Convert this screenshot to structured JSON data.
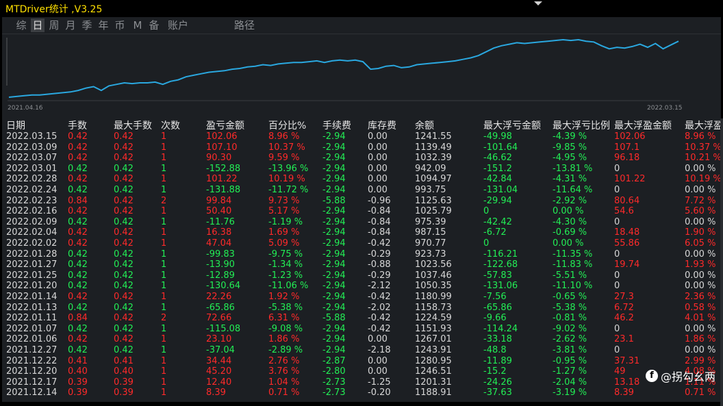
{
  "app": {
    "title": "MTDriver统计 ,V3.25"
  },
  "tabs": [
    {
      "label": "综",
      "active": false
    },
    {
      "label": "日",
      "active": true
    },
    {
      "label": "周",
      "active": false
    },
    {
      "label": "月",
      "active": false
    },
    {
      "label": "季",
      "active": false
    },
    {
      "label": "年",
      "active": false
    },
    {
      "label": "币",
      "active": false
    },
    {
      "label": "M",
      "active": false
    },
    {
      "label": "备",
      "active": false
    },
    {
      "label": "账户",
      "active": false
    },
    {
      "label": "路径",
      "active": false
    }
  ],
  "chart": {
    "start_label": "2021.04.16",
    "end_label": "2022.03.15",
    "line_color": "#2aa8e0"
  },
  "chart_data": {
    "type": "line",
    "title": "",
    "xlabel": "",
    "ylabel": "",
    "x_start": "2021.04.16",
    "x_end": "2022.03.15",
    "values": [
      0,
      1,
      2,
      3,
      3,
      4,
      5,
      6,
      7,
      9,
      12,
      14,
      9,
      15,
      17,
      19,
      18,
      19,
      19,
      20,
      17,
      21,
      23,
      27,
      29,
      31,
      33,
      34,
      35,
      37,
      38,
      40,
      41,
      43,
      42,
      44,
      45,
      46,
      46,
      47,
      48,
      46,
      48,
      49,
      48,
      49,
      47,
      37,
      38,
      41,
      42,
      39,
      40,
      43,
      44,
      45,
      46,
      47,
      48,
      50,
      52,
      55,
      60,
      65,
      68,
      70,
      72,
      71,
      72,
      73,
      74,
      75,
      76,
      75,
      76,
      74,
      73,
      68,
      64,
      66,
      65,
      67,
      70,
      66,
      71,
      64,
      69,
      74
    ],
    "line_color": "#2aa8e0",
    "grid": false,
    "legend": "none"
  },
  "colors": {
    "profit": "#ff2a2a",
    "loss": "#22ee55",
    "neutral": "#d8d8d8",
    "header": "#e6e6e6"
  },
  "table": {
    "columns": [
      "日期",
      "手数",
      "最大手数",
      "次数",
      "盈亏金额",
      "百分比%",
      "手续费",
      "库存费",
      "余额",
      "最大浮亏金额",
      "最大浮亏比例",
      "最大浮盈金额",
      "最大浮盈"
    ],
    "rows": [
      [
        "2022.03.15",
        "0.42",
        "0.42",
        "1",
        "102.06",
        "8.96 %",
        "-2.94",
        "0.00",
        "1241.55",
        "-49.98",
        "-4.39 %",
        "102.06",
        "8.96 %"
      ],
      [
        "2022.03.09",
        "0.42",
        "0.42",
        "1",
        "107.10",
        "10.37 %",
        "-2.94",
        "0.00",
        "1139.49",
        "-101.64",
        "-9.85 %",
        "107.1",
        "10.37 %"
      ],
      [
        "2022.03.07",
        "0.42",
        "0.42",
        "1",
        "90.30",
        "9.59 %",
        "-2.94",
        "0.00",
        "1032.39",
        "-46.62",
        "-4.95 %",
        "96.18",
        "10.21 %"
      ],
      [
        "2022.03.01",
        "0.42",
        "0.42",
        "1",
        "-152.88",
        "-13.96 %",
        "-2.94",
        "0.00",
        "942.09",
        "-151.2",
        "-13.81 %",
        "0",
        "0.00 %"
      ],
      [
        "2022.02.28",
        "0.42",
        "0.42",
        "1",
        "101.22",
        "10.19 %",
        "-2.94",
        "0.00",
        "1094.97",
        "-42.84",
        "-4.31 %",
        "101.22",
        "10.19 %"
      ],
      [
        "2022.02.24",
        "0.42",
        "0.42",
        "1",
        "-131.88",
        "-11.72 %",
        "-2.94",
        "0.00",
        "993.75",
        "-131.04",
        "-11.64 %",
        "0",
        "0.00 %"
      ],
      [
        "2022.02.23",
        "0.84",
        "0.42",
        "2",
        "99.84",
        "9.73 %",
        "-5.88",
        "-0.96",
        "1125.63",
        "-29.94",
        "-2.92 %",
        "80.64",
        "7.72 %"
      ],
      [
        "2022.02.16",
        "0.42",
        "0.42",
        "1",
        "50.40",
        "5.17 %",
        "-2.94",
        "-0.84",
        "1025.79",
        "0",
        "0.00 %",
        "54.6",
        "5.60 %"
      ],
      [
        "2022.02.09",
        "0.42",
        "0.42",
        "1",
        "-11.76",
        "-1.19 %",
        "-2.94",
        "-0.84",
        "975.39",
        "-42.42",
        "-4.30 %",
        "0",
        "0.00 %"
      ],
      [
        "2022.02.04",
        "0.42",
        "0.42",
        "1",
        "16.38",
        "1.69 %",
        "-2.94",
        "-0.84",
        "987.15",
        "-6.72",
        "-0.69 %",
        "18.48",
        "1.90 %"
      ],
      [
        "2022.02.02",
        "0.42",
        "0.42",
        "1",
        "47.04",
        "5.09 %",
        "-2.94",
        "-0.42",
        "970.77",
        "0",
        "0.00 %",
        "55.86",
        "6.05 %"
      ],
      [
        "2022.01.28",
        "0.42",
        "0.42",
        "1",
        "-99.83",
        "-9.75 %",
        "-2.94",
        "-0.29",
        "923.73",
        "-116.21",
        "-11.35 %",
        "0",
        "0.00 %"
      ],
      [
        "2022.01.27",
        "0.42",
        "0.42",
        "1",
        "-13.90",
        "-1.34 %",
        "-2.94",
        "-0.88",
        "1023.56",
        "-122.68",
        "-11.83 %",
        "19.74",
        "1.93 %"
      ],
      [
        "2022.01.25",
        "0.42",
        "0.42",
        "1",
        "-12.89",
        "-1.23 %",
        "-2.94",
        "-0.29",
        "1037.46",
        "-57.83",
        "-5.51 %",
        "0",
        "0.00 %"
      ],
      [
        "2022.01.20",
        "0.42",
        "0.42",
        "1",
        "-130.64",
        "-11.06 %",
        "-2.94",
        "-2.12",
        "1050.35",
        "-131.06",
        "-11.10 %",
        "0",
        "0.00 %"
      ],
      [
        "2022.01.14",
        "0.42",
        "0.42",
        "1",
        "22.26",
        "1.92 %",
        "-2.94",
        "-0.42",
        "1180.99",
        "-7.56",
        "-0.65 %",
        "27.3",
        "2.36 %"
      ],
      [
        "2022.01.13",
        "0.42",
        "0.42",
        "1",
        "-65.86",
        "-5.38 %",
        "-2.94",
        "-2.02",
        "1158.73",
        "-65.86",
        "-5.38 %",
        "6.72",
        "0.58 %"
      ],
      [
        "2022.01.11",
        "0.84",
        "0.42",
        "2",
        "72.66",
        "6.31 %",
        "-5.88",
        "-0.42",
        "1224.59",
        "-9.66",
        "-0.81 %",
        "46.2",
        "4.01 %"
      ],
      [
        "2022.01.07",
        "0.42",
        "0.42",
        "1",
        "-115.08",
        "-9.08 %",
        "-2.94",
        "-0.42",
        "1151.93",
        "-114.24",
        "-9.02 %",
        "0",
        "0.00 %"
      ],
      [
        "2022.01.06",
        "0.42",
        "0.42",
        "1",
        "23.10",
        "1.86 %",
        "-2.94",
        "0.00",
        "1267.01",
        "-33.18",
        "-2.62 %",
        "23.1",
        "1.86 %"
      ],
      [
        "2021.12.27",
        "0.42",
        "0.42",
        "1",
        "-37.04",
        "-2.89 %",
        "-2.94",
        "-2.18",
        "1243.91",
        "-48.8",
        "-3.81 %",
        "0",
        "0.00 %"
      ],
      [
        "2021.12.22",
        "0.41",
        "0.41",
        "1",
        "34.44",
        "2.76 %",
        "-2.87",
        "0.00",
        "1280.95",
        "-11.89",
        "-0.95 %",
        "37.31",
        "2.99 %"
      ],
      [
        "2021.12.20",
        "0.40",
        "0.40",
        "1",
        "45.20",
        "3.76 %",
        "-2.80",
        "0.00",
        "1246.51",
        "-15.2",
        "-1.27 %",
        "49",
        "4.08 %"
      ],
      [
        "2021.12.17",
        "0.39",
        "0.39",
        "1",
        "12.40",
        "1.04 %",
        "-2.73",
        "-1.25",
        "1201.31",
        "-24.26",
        "-2.04 %",
        "13.18",
        "1.11 %"
      ],
      [
        "2021.12.14",
        "0.39",
        "0.39",
        "1",
        "8.39",
        "0.71 %",
        "-2.73",
        "-0.20",
        "1188.91",
        "-37.63",
        "-3.19 %",
        "8.39",
        "0.71 %"
      ]
    ]
  },
  "watermark": {
    "icon": "f",
    "text": "@拐勾幺两"
  }
}
